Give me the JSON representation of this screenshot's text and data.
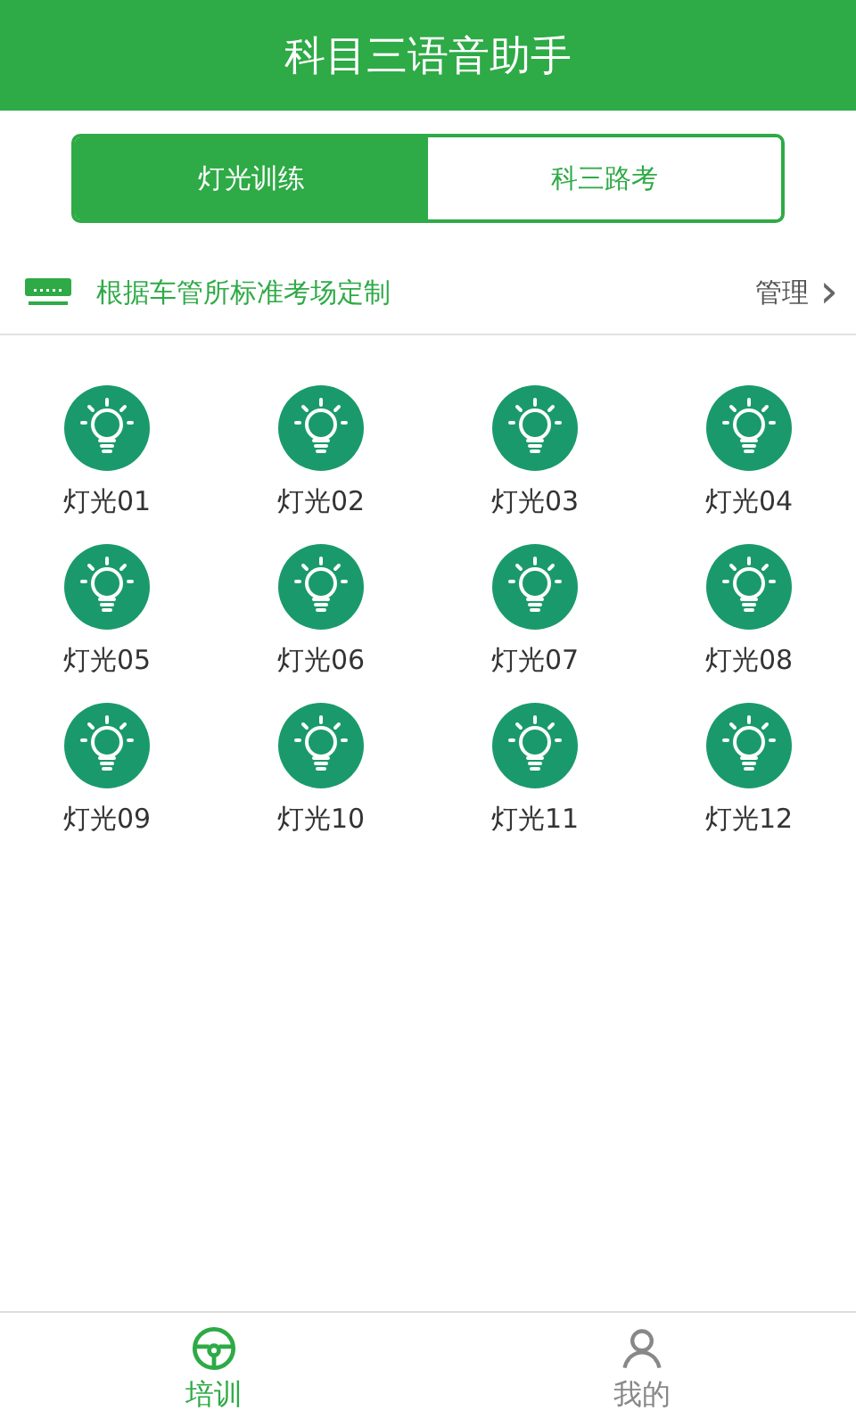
{
  "header": {
    "title": "科目三语音助手"
  },
  "tabs": [
    {
      "label": "灯光训练",
      "selected": true
    },
    {
      "label": "科三路考",
      "selected": false
    }
  ],
  "info_bar": {
    "text": "根据车管所标准考场定制",
    "action": "管理",
    "chevron": "›"
  },
  "lights": [
    {
      "label": "灯光01"
    },
    {
      "label": "灯光02"
    },
    {
      "label": "灯光03"
    },
    {
      "label": "灯光04"
    },
    {
      "label": "灯光05"
    },
    {
      "label": "灯光06"
    },
    {
      "label": "灯光07"
    },
    {
      "label": "灯光08"
    },
    {
      "label": "灯光09"
    },
    {
      "label": "灯光10"
    },
    {
      "label": "灯光11"
    },
    {
      "label": "灯光12"
    }
  ],
  "bottom_nav": [
    {
      "label": "培训",
      "kind": "wheel",
      "selected": true
    },
    {
      "label": "我的",
      "kind": "person",
      "selected": false
    }
  ]
}
